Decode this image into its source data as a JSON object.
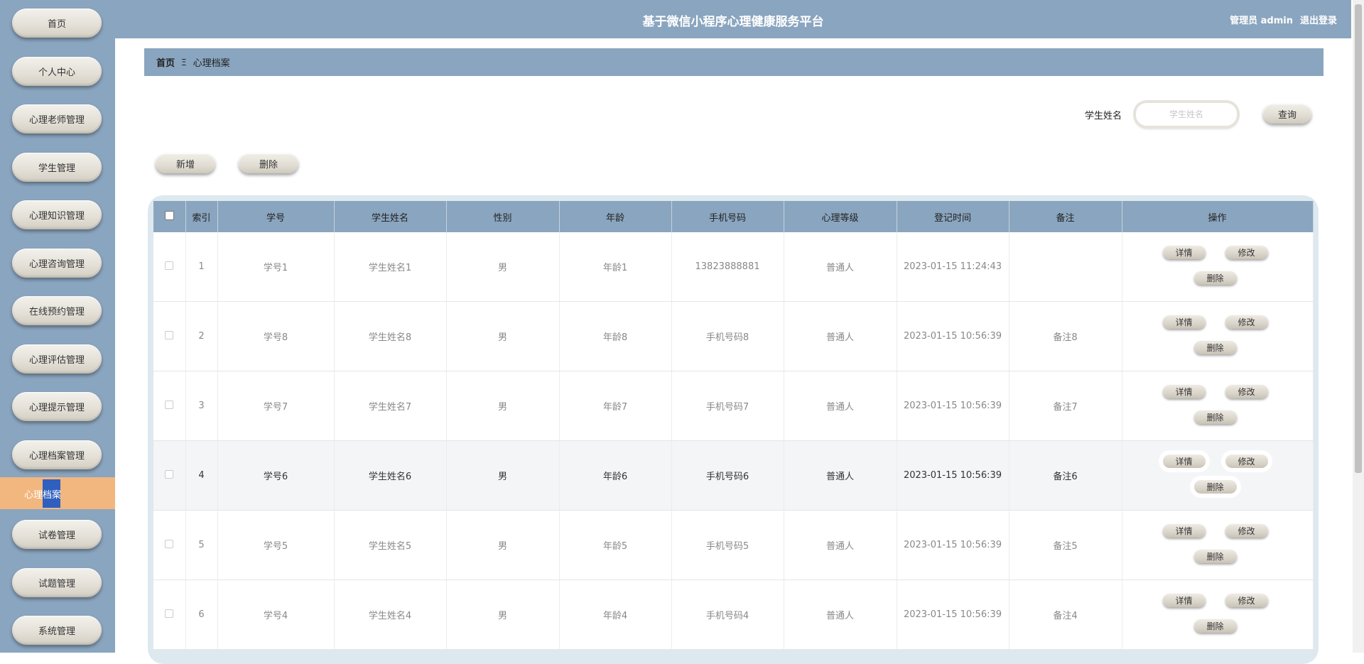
{
  "app": {
    "title": "基于微信小程序心理健康服务平台",
    "user_label": "管理员 admin",
    "logout_label": "退出登录"
  },
  "sidebar": {
    "items": [
      {
        "label": "首页"
      },
      {
        "label": "个人中心"
      },
      {
        "label": "心理老师管理"
      },
      {
        "label": "学生管理"
      },
      {
        "label": "心理知识管理"
      },
      {
        "label": "心理咨询管理"
      },
      {
        "label": "在线预约管理"
      },
      {
        "label": "心理评估管理"
      },
      {
        "label": "心理提示管理"
      },
      {
        "label": "心理档案管理"
      },
      {
        "label": "试卷管理"
      },
      {
        "label": "试题管理"
      },
      {
        "label": "系统管理"
      }
    ],
    "active_sub": {
      "label": "心理档案"
    }
  },
  "breadcrumb": {
    "home": "首页",
    "separator": "Ξ",
    "current": "心理档案"
  },
  "search": {
    "label": "学生姓名",
    "placeholder": "学生姓名",
    "button_label": "查询"
  },
  "toolbar": {
    "add_label": "新增",
    "delete_label": "删除"
  },
  "table": {
    "columns": [
      "索引",
      "学号",
      "学生姓名",
      "性别",
      "年龄",
      "手机号码",
      "心理等级",
      "登记时间",
      "备注",
      "操作"
    ],
    "rows": [
      {
        "index": "1",
        "student_id": "学号1",
        "name": "学生姓名1",
        "gender": "男",
        "age": "年龄1",
        "phone": "13823888881",
        "level": "普通人",
        "time": "2023-01-15 11:24:43",
        "note": ""
      },
      {
        "index": "2",
        "student_id": "学号8",
        "name": "学生姓名8",
        "gender": "男",
        "age": "年龄8",
        "phone": "手机号码8",
        "level": "普通人",
        "time": "2023-01-15 10:56:39",
        "note": "备注8"
      },
      {
        "index": "3",
        "student_id": "学号7",
        "name": "学生姓名7",
        "gender": "男",
        "age": "年龄7",
        "phone": "手机号码7",
        "level": "普通人",
        "time": "2023-01-15 10:56:39",
        "note": "备注7"
      },
      {
        "index": "4",
        "student_id": "学号6",
        "name": "学生姓名6",
        "gender": "男",
        "age": "年龄6",
        "phone": "手机号码6",
        "level": "普通人",
        "time": "2023-01-15 10:56:39",
        "note": "备注6"
      },
      {
        "index": "5",
        "student_id": "学号5",
        "name": "学生姓名5",
        "gender": "男",
        "age": "年龄5",
        "phone": "手机号码5",
        "level": "普通人",
        "time": "2023-01-15 10:56:39",
        "note": "备注5"
      },
      {
        "index": "6",
        "student_id": "学号4",
        "name": "学生姓名4",
        "gender": "男",
        "age": "年龄4",
        "phone": "手机号码4",
        "level": "普通人",
        "time": "2023-01-15 10:56:39",
        "note": "备注4"
      }
    ],
    "row_actions": {
      "detail": "详情",
      "edit": "修改",
      "delete": "删除"
    }
  },
  "colors": {
    "header_bg": "#8aa5bf",
    "active_menu_bg": "#f2b67f",
    "table_frame": "#dde9ef"
  }
}
